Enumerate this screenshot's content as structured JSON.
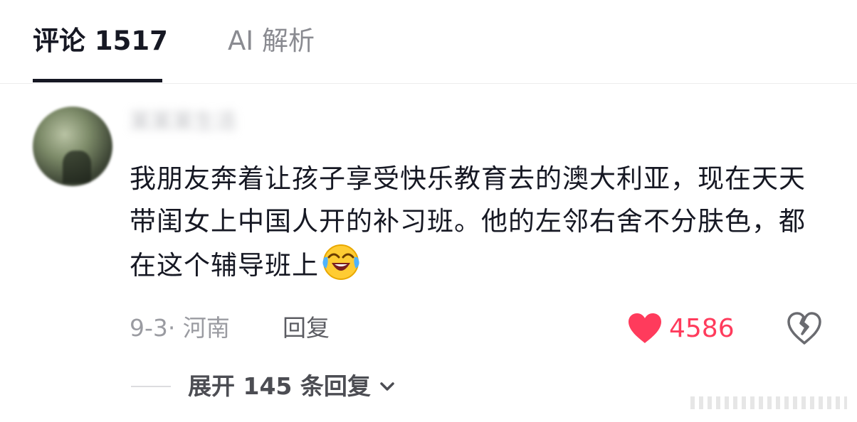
{
  "tabs": {
    "comments": "评论 1517",
    "ai": "AI 解析"
  },
  "comment": {
    "username": "某某某生活",
    "text": "我朋友奔着让孩子享受快乐教育去的澳大利亚，现在天天带闺女上中国人开的补习班。他的左邻右舍不分肤色，都在这个辅导班上",
    "emoji": "laughing-crying-emoji",
    "time_location": "9-3· 河南",
    "reply_label": "回复",
    "like_count": "4586",
    "expand_label": "展开 145 条回复"
  },
  "colors": {
    "like_red": "#ff3b5c",
    "text_primary": "#161823",
    "text_secondary": "#9a9ba1"
  }
}
